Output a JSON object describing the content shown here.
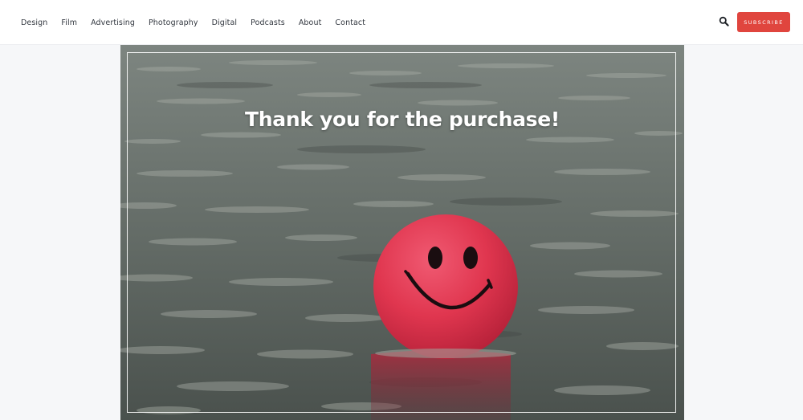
{
  "nav": {
    "items": [
      {
        "label": "Design"
      },
      {
        "label": "Film"
      },
      {
        "label": "Advertising"
      },
      {
        "label": "Photography"
      },
      {
        "label": "Digital"
      },
      {
        "label": "Podcasts"
      },
      {
        "label": "About"
      },
      {
        "label": "Contact"
      }
    ]
  },
  "header": {
    "search_icon": "search-icon",
    "subscribe_label": "SUBSCRIBE"
  },
  "hero": {
    "title": "Thank you for the purchase!",
    "image": "smiley-ball-in-water"
  },
  "colors": {
    "accent": "#e0453e",
    "ball": "#e3364f"
  }
}
